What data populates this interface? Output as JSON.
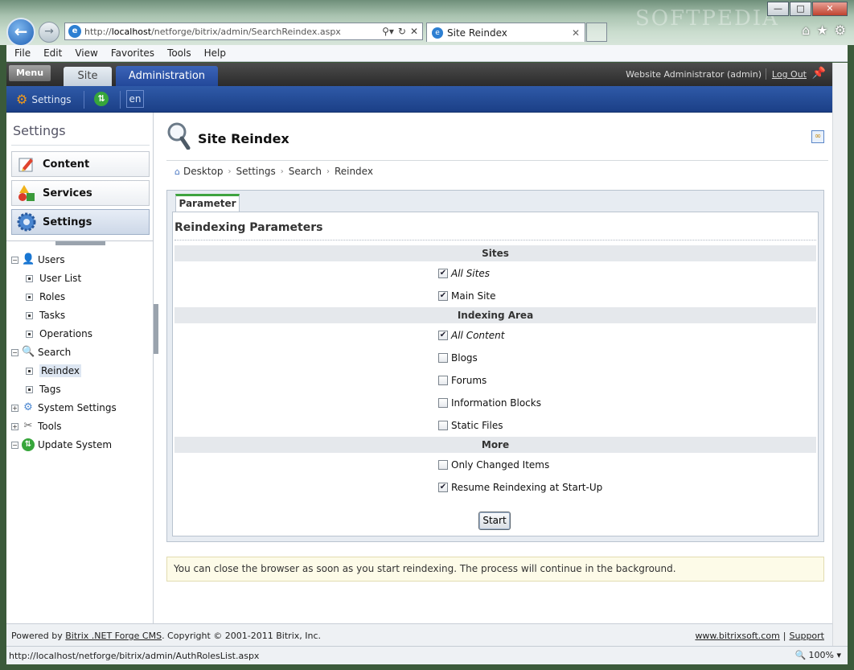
{
  "browser": {
    "url_prefix": "http://",
    "url_host": "localhost",
    "url_path": "/netforge/bitrix/admin/SearchReindex.aspx",
    "tab_title": "Site Reindex",
    "watermark": "SOFTPEDIA",
    "menu": [
      "File",
      "Edit",
      "View",
      "Favorites",
      "Tools",
      "Help"
    ],
    "status_url": "http://localhost/netforge/bitrix/admin/AuthRolesList.aspx",
    "zoom": "100%"
  },
  "topbar": {
    "menu_label": "Menu",
    "tab_site": "Site",
    "tab_admin": "Administration",
    "user": "Website Administrator (admin)",
    "logout": "Log Out"
  },
  "toolbar": {
    "settings_label": "Settings",
    "lang": "en"
  },
  "sidebar": {
    "title": "Settings",
    "sections": [
      {
        "label": "Content",
        "icon": "pencil-icon"
      },
      {
        "label": "Services",
        "icon": "shapes-icon"
      },
      {
        "label": "Settings",
        "icon": "gear-icon"
      }
    ],
    "tree": [
      {
        "label": "Users",
        "icon": "user-icon",
        "expanded": true
      },
      {
        "label": "User List"
      },
      {
        "label": "Roles"
      },
      {
        "label": "Tasks"
      },
      {
        "label": "Operations"
      },
      {
        "label": "Search",
        "icon": "search-icon",
        "expanded": true
      },
      {
        "label": "Reindex",
        "selected": true
      },
      {
        "label": "Tags"
      },
      {
        "label": "System Settings",
        "icon": "gear-icon",
        "expanded": false
      },
      {
        "label": "Tools",
        "icon": "tools-icon",
        "expanded": false
      },
      {
        "label": "Update System",
        "icon": "update-icon",
        "expanded": true
      }
    ]
  },
  "main": {
    "title": "Site Reindex",
    "breadcrumb": [
      "Desktop",
      "Settings",
      "Search",
      "Reindex"
    ],
    "tab_label": "Parameter",
    "form_title": "Reindexing Parameters",
    "sections": {
      "sites": "Sites",
      "indexing_area": "Indexing Area",
      "more": "More"
    },
    "checkboxes": {
      "all_sites": {
        "label": "All Sites",
        "checked": true
      },
      "main_site": {
        "label": "Main Site",
        "checked": true
      },
      "all_content": {
        "label": "All Content",
        "checked": true
      },
      "blogs": {
        "label": "Blogs",
        "checked": false
      },
      "forums": {
        "label": "Forums",
        "checked": false
      },
      "information_blocks": {
        "label": "Information Blocks",
        "checked": false
      },
      "static_files": {
        "label": "Static Files",
        "checked": false
      },
      "only_changed": {
        "label": "Only Changed Items",
        "checked": false
      },
      "resume": {
        "label": "Resume Reindexing at Start-Up",
        "checked": true
      }
    },
    "start_label": "Start",
    "notice": "You can close the browser as soon as you start reindexing. The process will continue in the background."
  },
  "footer": {
    "powered_prefix": "Powered by ",
    "product_link": "Bitrix .NET Forge CMS",
    "copyright": ". Copyright © 2001-2011 Bitrix, Inc.",
    "site_link": "www.bitrixsoft.com",
    "support_link": "Support"
  }
}
